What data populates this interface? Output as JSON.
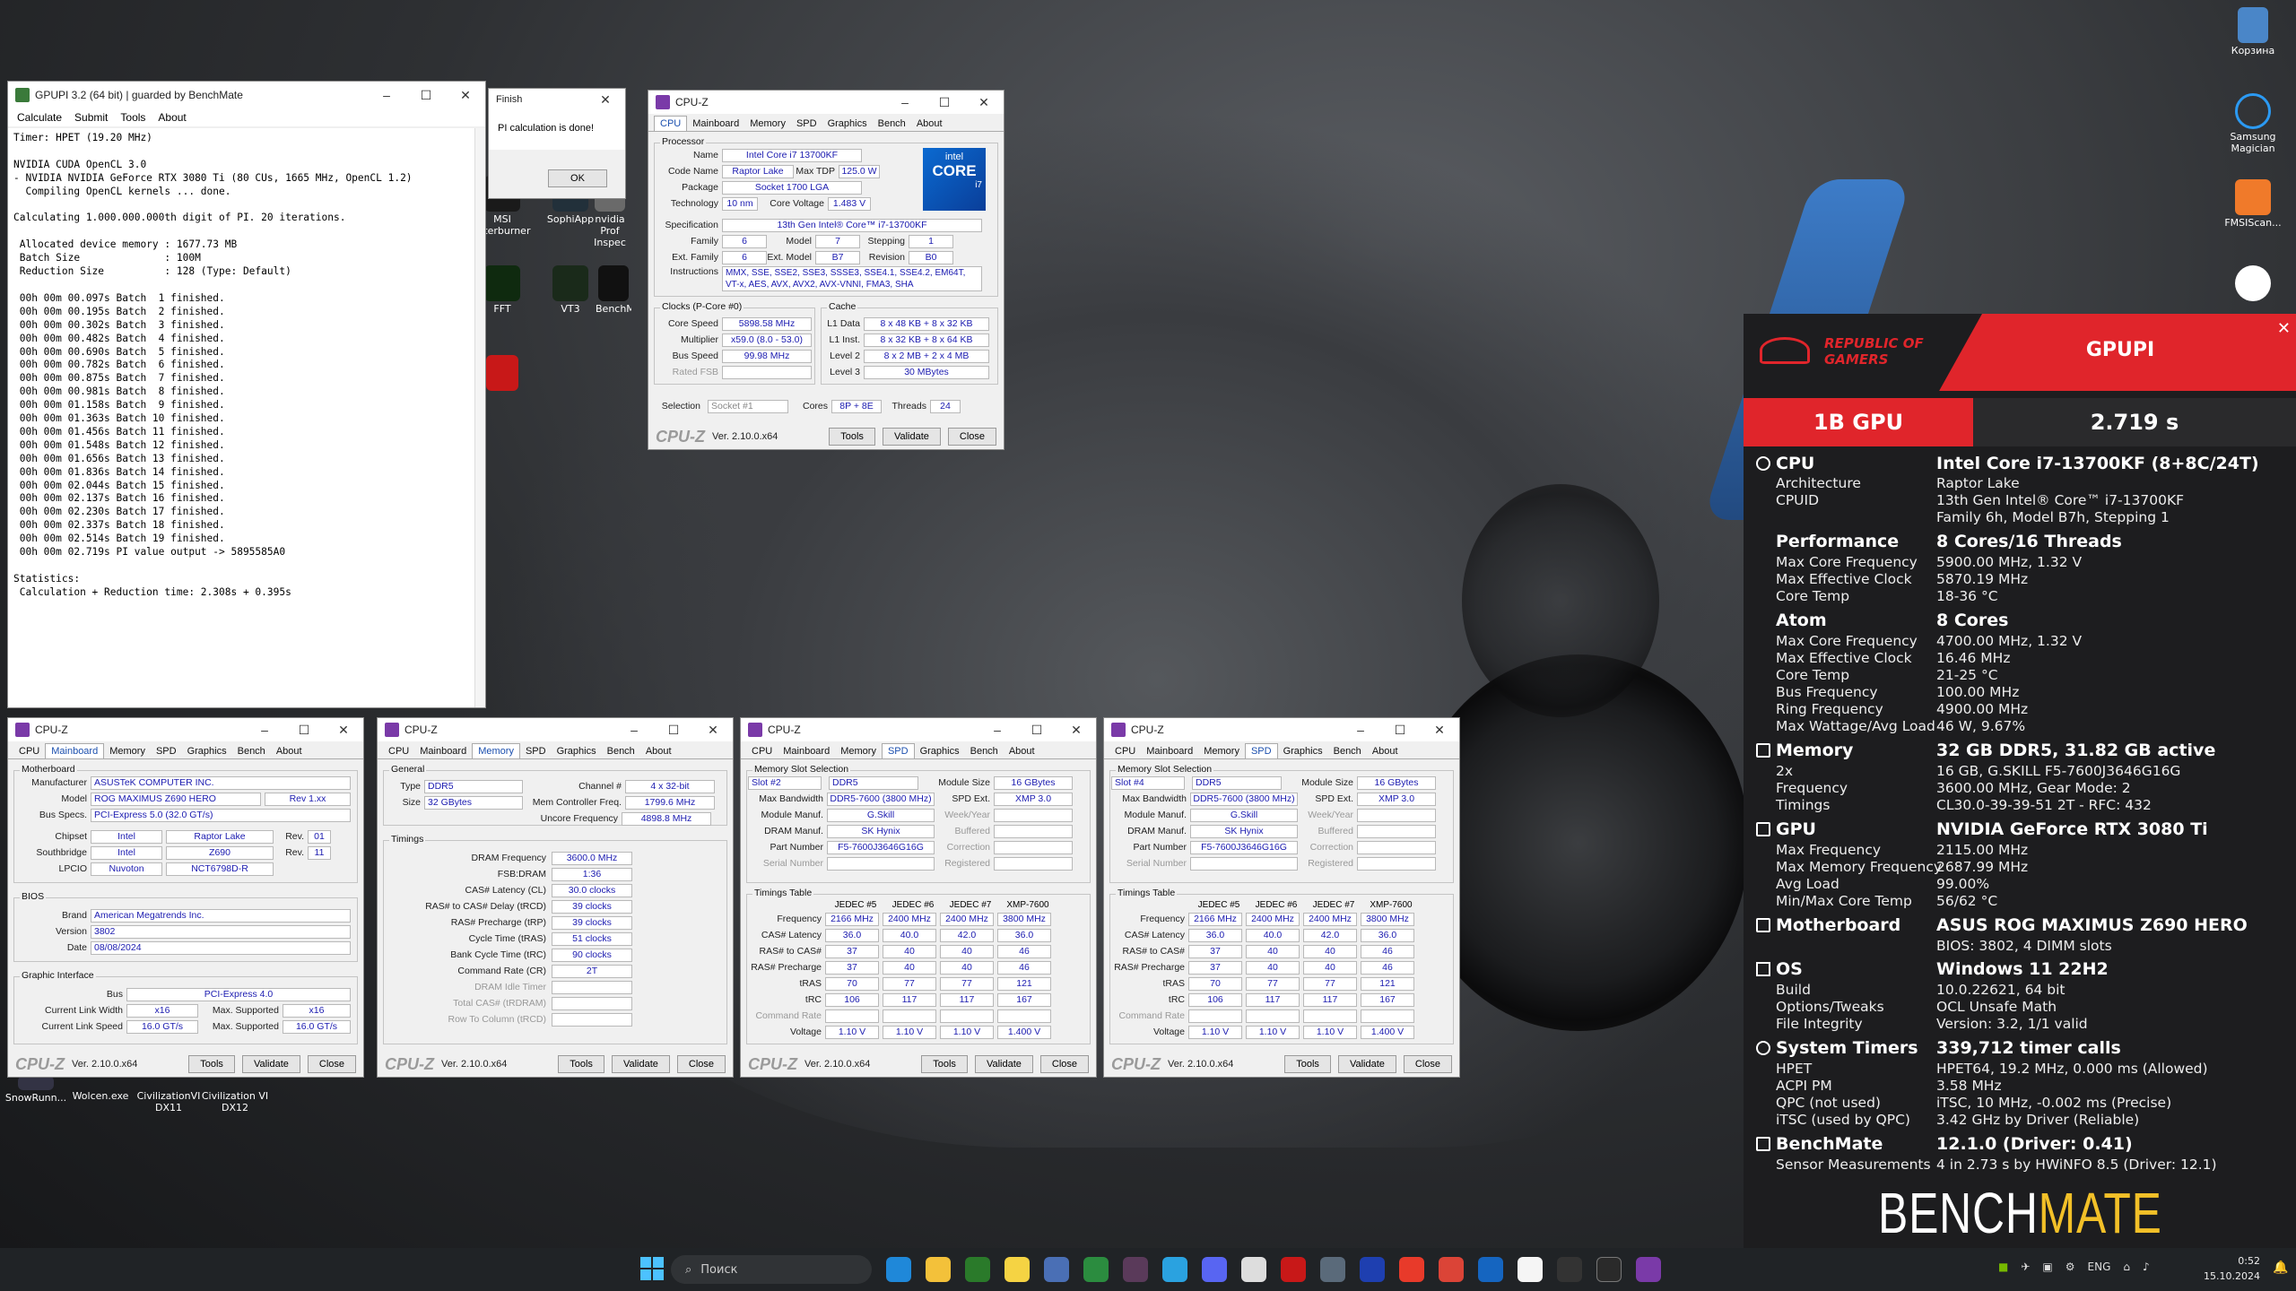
{
  "desktop": {
    "recycle": "Корзина",
    "samsung": "Samsung Magician",
    "fmsi": "FMSIScan...",
    "msi": "MSI Afterburner",
    "sophi": "SophiApp",
    "nvidia": "nvidia Prof Inspec",
    "fft": "FFT",
    "vt3": "VT3",
    "bench": "BenchM...",
    "snow": "SnowRunn...",
    "wolcen": "Wolcen.exe",
    "civ11": "CivilizationVI DX11",
    "civ12": "Civilization VI DX12"
  },
  "gpupi": {
    "title": "GPUPI 3.2 (64 bit) | guarded by BenchMate",
    "menu": [
      "Calculate",
      "Submit",
      "Tools",
      "About"
    ],
    "log": "Timer: HPET (19.20 MHz)\n\nNVIDIA CUDA OpenCL 3.0\n- NVIDIA NVIDIA GeForce RTX 3080 Ti (80 CUs, 1665 MHz, OpenCL 1.2)\n  Compiling OpenCL kernels ... done.\n\nCalculating 1.000.000.000th digit of PI. 20 iterations.\n\n Allocated device memory : 1677.73 MB\n Batch Size              : 100M\n Reduction Size          : 128 (Type: Default)\n\n 00h 00m 00.097s Batch  1 finished.\n 00h 00m 00.195s Batch  2 finished.\n 00h 00m 00.302s Batch  3 finished.\n 00h 00m 00.482s Batch  4 finished.\n 00h 00m 00.690s Batch  5 finished.\n 00h 00m 00.782s Batch  6 finished.\n 00h 00m 00.875s Batch  7 finished.\n 00h 00m 00.981s Batch  8 finished.\n 00h 00m 01.158s Batch  9 finished.\n 00h 00m 01.363s Batch 10 finished.\n 00h 00m 01.456s Batch 11 finished.\n 00h 00m 01.548s Batch 12 finished.\n 00h 00m 01.656s Batch 13 finished.\n 00h 00m 01.836s Batch 14 finished.\n 00h 00m 02.044s Batch 15 finished.\n 00h 00m 02.137s Batch 16 finished.\n 00h 00m 02.230s Batch 17 finished.\n 00h 00m 02.337s Batch 18 finished.\n 00h 00m 02.514s Batch 19 finished.\n 00h 00m 02.719s PI value output -> 5895585A0\n\nStatistics:\n Calculation + Reduction time: 2.308s + 0.395s"
  },
  "finish": {
    "title": "Finish",
    "msg": "PI calculation is done!",
    "ok": "OK"
  },
  "cpuz_tabs": [
    "CPU",
    "Mainboard",
    "Memory",
    "SPD",
    "Graphics",
    "Bench",
    "About"
  ],
  "cpuz_common": {
    "title": "CPU-Z",
    "brand": "CPU-Z",
    "ver": "Ver. 2.10.0.x64",
    "tools": "Tools",
    "validate": "Validate",
    "close": "Close"
  },
  "cpu": {
    "g_proc": "Processor",
    "name_l": "Name",
    "name": "Intel Core i7 13700KF",
    "code_l": "Code Name",
    "code": "Raptor Lake",
    "tdp_l": "Max TDP",
    "tdp": "125.0 W",
    "pkg_l": "Package",
    "pkg": "Socket 1700 LGA",
    "tech_l": "Technology",
    "tech": "10 nm",
    "cv_l": "Core Voltage",
    "cv": "1.483 V",
    "spec_l": "Specification",
    "spec": "13th Gen Intel® Core™ i7-13700KF",
    "fam_l": "Family",
    "fam": "6",
    "mod_l": "Model",
    "mod": "7",
    "step_l": "Stepping",
    "step": "1",
    "efam_l": "Ext. Family",
    "efam": "6",
    "emod_l": "Ext. Model",
    "emod": "B7",
    "rev_l": "Revision",
    "rev": "B0",
    "instr_l": "Instructions",
    "instr": "MMX, SSE, SSE2, SSE3, SSSE3, SSE4.1, SSE4.2, EM64T, VT-x, AES, AVX, AVX2, AVX-VNNI, FMA3, SHA",
    "g_clk": "Clocks (P-Core #0)",
    "cs_l": "Core Speed",
    "cs": "5898.58 MHz",
    "mul_l": "Multiplier",
    "mul": "x59.0 (8.0 - 53.0)",
    "bus_l": "Bus Speed",
    "bus": "99.98 MHz",
    "fsb_l": "Rated FSB",
    "g_cache": "Cache",
    "l1d_l": "L1 Data",
    "l1d": "8 x 48 KB + 8 x 32 KB",
    "l1i_l": "L1 Inst.",
    "l1i": "8 x 32 KB + 8 x 64 KB",
    "l2_l": "Level 2",
    "l2": "8 x 2 MB + 2 x 4 MB",
    "l3_l": "Level 3",
    "l3": "30 MBytes",
    "sel_l": "Selection",
    "sel": "Socket #1",
    "cores_l": "Cores",
    "cores": "8P + 8E",
    "thr_l": "Threads",
    "thr": "24",
    "intel": "intel",
    "core": "CORE",
    "i7": "i7"
  },
  "mb": {
    "g_mb": "Motherboard",
    "man_l": "Manufacturer",
    "man": "ASUSTeK COMPUTER INC.",
    "model_l": "Model",
    "model": "ROG MAXIMUS Z690 HERO",
    "rev": "Rev 1.xx",
    "bus_l": "Bus Specs.",
    "bus": "PCI-Express 5.0 (32.0 GT/s)",
    "chip_l": "Chipset",
    "chip": "Intel",
    "chip2": "Raptor Lake",
    "chiprev": "01",
    "sb_l": "Southbridge",
    "sb": "Intel",
    "sb2": "Z690",
    "sbrev": "11",
    "lpc_l": "LPCIO",
    "lpc": "Nuvoton",
    "lpc2": "NCT6798D-R",
    "rev_l": "Rev.",
    "g_bios": "BIOS",
    "brand_l": "Brand",
    "brand": "American Megatrends Inc.",
    "ver_l": "Version",
    "ver": "3802",
    "date_l": "Date",
    "date": "08/08/2024",
    "g_gi": "Graphic Interface",
    "gbus_l": "Bus",
    "gbus": "PCI-Express 4.0",
    "clw_l": "Current Link Width",
    "clw": "x16",
    "msw_l": "Max. Supported",
    "msw": "x16",
    "cls_l": "Current Link Speed",
    "cls": "16.0 GT/s",
    "mss_l": "Max. Supported",
    "mss": "16.0 GT/s"
  },
  "mem": {
    "g_gen": "General",
    "type_l": "Type",
    "type": "DDR5",
    "ch_l": "Channel #",
    "ch": "4 x 32-bit",
    "size_l": "Size",
    "size": "32 GBytes",
    "mcf_l": "Mem Controller Freq.",
    "mcf": "1799.6 MHz",
    "unc_l": "Uncore Frequency",
    "unc": "4898.8 MHz",
    "g_tim": "Timings",
    "rows": [
      [
        "DRAM Frequency",
        "3600.0 MHz"
      ],
      [
        "FSB:DRAM",
        "1:36"
      ],
      [
        "CAS# Latency (CL)",
        "30.0 clocks"
      ],
      [
        "RAS# to CAS# Delay (tRCD)",
        "39 clocks"
      ],
      [
        "RAS# Precharge (tRP)",
        "39 clocks"
      ],
      [
        "Cycle Time (tRAS)",
        "51 clocks"
      ],
      [
        "Bank Cycle Time (tRC)",
        "90 clocks"
      ],
      [
        "Command Rate (CR)",
        "2T"
      ],
      [
        "DRAM Idle Timer",
        ""
      ],
      [
        "Total CAS# (tRDRAM)",
        ""
      ],
      [
        "Row To Column (tRCD)",
        ""
      ]
    ]
  },
  "spd": {
    "g_slot": "Memory Slot Selection",
    "mbw_l": "Max Bandwidth",
    "mbw": "DDR5-7600 (3800 MHz)",
    "mm_l": "Module Manuf.",
    "mm": "G.Skill",
    "dm_l": "DRAM Manuf.",
    "dm": "SK Hynix",
    "pn_l": "Part Number",
    "pn": "F5-7600J3646G16G",
    "sn_l": "Serial Number",
    "ms_l": "Module Size",
    "ms": "16 GBytes",
    "se_l": "SPD Ext.",
    "se": "XMP 3.0",
    "wy_l": "Week/Year",
    "bf_l": "Buffered",
    "co_l": "Correction",
    "rg_l": "Registered",
    "type": "DDR5",
    "g_tt": "Timings Table",
    "cols": [
      "JEDEC #5",
      "JEDEC #6",
      "JEDEC #7",
      "XMP-7600"
    ],
    "trows": [
      [
        "Frequency",
        "2166 MHz",
        "2400 MHz",
        "2400 MHz",
        "3800 MHz"
      ],
      [
        "CAS# Latency",
        "36.0",
        "40.0",
        "42.0",
        "36.0"
      ],
      [
        "RAS# to CAS#",
        "37",
        "40",
        "40",
        "46"
      ],
      [
        "RAS# Precharge",
        "37",
        "40",
        "40",
        "46"
      ],
      [
        "tRAS",
        "70",
        "77",
        "77",
        "121"
      ],
      [
        "tRC",
        "106",
        "117",
        "117",
        "167"
      ],
      [
        "Command Rate",
        "",
        "",
        "",
        ""
      ],
      [
        "Voltage",
        "1.10 V",
        "1.10 V",
        "1.10 V",
        "1.400 V"
      ]
    ],
    "slot2": "Slot #2",
    "slot4": "Slot #4"
  },
  "bm": {
    "rog1": "REPUBLIC OF",
    "rog2": "GAMERS",
    "app": "GPUPI",
    "cat": "1B GPU",
    "score": "2.719 s",
    "cpu_h": "CPU",
    "cpu_v": "Intel Core i7-13700KF (8+8C/24T)",
    "arch_k": "Architecture",
    "arch_v": "Raptor Lake",
    "cpuid_k": "CPUID",
    "cpuid_v": "13th Gen Intel® Core™ i7-13700KF",
    "cpuid_v2": "Family 6h, Model B7h, Stepping 1",
    "perf_h": "Performance",
    "perf_v": "8 Cores/16 Threads",
    "mcf_k": "Max Core Frequency",
    "mcf_v": "5900.00 MHz, 1.32 V",
    "mec_k": "Max Effective Clock",
    "mec_v": "5870.19 MHz",
    "ct_k": "Core Temp",
    "ct_v": "18-36 °C",
    "atom_h": "Atom",
    "atom_v": "8 Cores",
    "amcf_k": "Max Core Frequency",
    "amcf_v": "4700.00 MHz, 1.32 V",
    "amec_k": "Max Effective Clock",
    "amec_v": "16.46 MHz",
    "act_k": "Core Temp",
    "act_v": "21-25 °C",
    "bus_k": "Bus Frequency",
    "bus_v": "100.00 MHz",
    "ring_k": "Ring Frequency",
    "ring_v": "4900.00 MHz",
    "mw_k": "Max Wattage/Avg Load",
    "mw_v": "46 W, 9.67%",
    "mem_h": "Memory",
    "mem_v": "32 GB DDR5, 31.82 GB active",
    "x2_k": "2x",
    "x2_v": "16 GB, G.SKILL F5-7600J3646G16G",
    "freq_k": "Frequency",
    "freq_v": "3600.00 MHz, Gear Mode: 2",
    "tim_k": "Timings",
    "tim_v": "CL30.0-39-39-51 2T - RFC: 432",
    "gpu_h": "GPU",
    "gpu_v": "NVIDIA GeForce RTX 3080 Ti",
    "gmf_k": "Max Frequency",
    "gmf_v": "2115.00 MHz",
    "gmm_k": "Max Memory Frequency",
    "gmm_v": "2687.99 MHz",
    "gal_k": "Avg Load",
    "gal_v": "99.00%",
    "gmt_k": "Min/Max Core Temp",
    "gmt_v": "56/62 °C",
    "mb_h": "Motherboard",
    "mb_v": "ASUS ROG MAXIMUS Z690 HERO",
    "mb_sub": "BIOS: 3802, 4 DIMM slots",
    "os_h": "OS",
    "os_v": "Windows 11 22H2",
    "build_k": "Build",
    "build_v": "10.0.22621, 64 bit",
    "opt_k": "Options/Tweaks",
    "opt_v": "OCL Unsafe Math",
    "fi_k": "File Integrity",
    "fi_v": "Version: 3.2, 1/1 valid",
    "st_h": "System Timers",
    "st_v": "339,712 timer calls",
    "hpet_k": "HPET",
    "hpet_v": "HPET64, 19.2 MHz, 0.000 ms (Allowed)",
    "acpi_k": "ACPI PM",
    "acpi_v": "3.58 MHz",
    "qpc_k": "QPC (not used)",
    "qpc_v": "iTSC, 10 MHz, -0.002 ms (Precise)",
    "itsc_k": "iTSC (used by QPC)",
    "itsc_v": "3.42 GHz by Driver (Reliable)",
    "bmh": "BenchMate",
    "bmv": "12.1.0 (Driver: 0.41)",
    "sm_k": "Sensor Measurements",
    "sm_v": "4 in 2.73 s by HWiNFO 8.5 (Driver: 12.1)",
    "logo1": "BENCH",
    "logo2": "MATE"
  },
  "taskbar": {
    "search": "Поиск",
    "lang": "ENG",
    "time": "0:52",
    "date": "15.10.2024"
  }
}
